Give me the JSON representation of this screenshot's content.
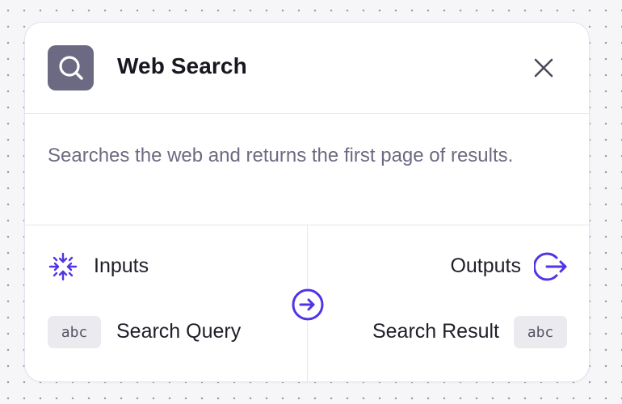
{
  "node": {
    "title": "Web Search",
    "icon": "search-icon",
    "close_icon": "close-icon",
    "description": "Searches the web and returns the first page of results."
  },
  "inputs": {
    "label": "Inputs",
    "icon": "collapse-arrows-icon",
    "items": [
      {
        "type": "abc",
        "name": "Search Query"
      }
    ]
  },
  "outputs": {
    "label": "Outputs",
    "icon": "exit-arrow-icon",
    "items": [
      {
        "type": "abc",
        "name": "Search Result"
      }
    ]
  },
  "connector_icon": "arrow-right-circle-icon",
  "colors": {
    "accent": "#5234e6",
    "icon_bg": "#6b6a82",
    "canvas_bg": "#f6f6f9",
    "badge_bg": "#ebebef",
    "description_text": "#6c6b82"
  }
}
